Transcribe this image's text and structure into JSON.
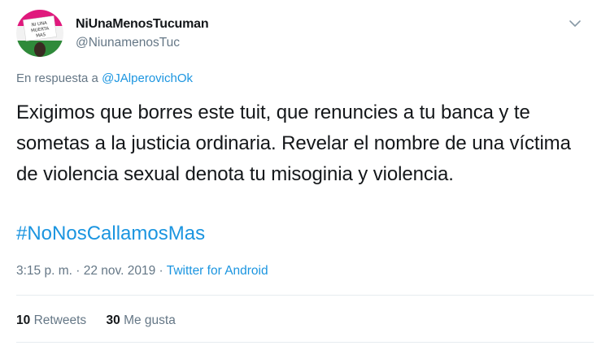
{
  "user": {
    "display_name": "NiUnaMenosTucuman",
    "handle": "@NiunamenosTuc",
    "avatar_sign_text": "NI UNA MUERTA MAS"
  },
  "reply": {
    "prefix": "En respuesta a",
    "mention": "@JAlperovichOk"
  },
  "tweet": {
    "text": "Exigimos que borres este tuit, que renuncies a tu banca y te sometas a la justicia ordinaria. Revelar el nombre de una víctima de violencia sexual denota tu misoginia y violencia.",
    "hashtag": "#NoNosCallamosMas"
  },
  "meta": {
    "time": "3:15 p. m.",
    "separator": " · ",
    "date": "22 nov. 2019",
    "source": "Twitter for Android"
  },
  "stats": {
    "retweets_count": "10",
    "retweets_label": "Retweets",
    "likes_count": "30",
    "likes_label": "Me gusta"
  },
  "icons": {
    "caret": "chevron-down-icon"
  },
  "colors": {
    "link": "#1b95e0",
    "secondary_text": "#657786",
    "avatar_pink": "#e0197d",
    "avatar_green": "#2f8a3a"
  }
}
